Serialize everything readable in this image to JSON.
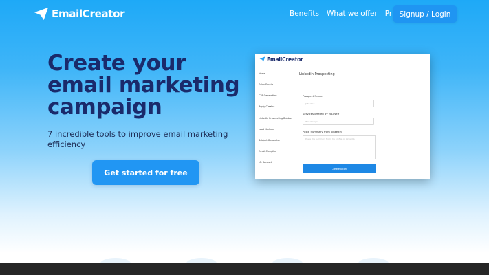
{
  "brand": {
    "name": "EmailCreator",
    "logo_icon": "paper-plane-icon",
    "color": "#ffffff"
  },
  "nav": {
    "links": [
      "Benefits",
      "What we offer",
      "Pricing"
    ],
    "signup_label": "Signup / Login"
  },
  "hero": {
    "title": "Create your email marketing campaign",
    "subtitle": "7 incredible tools to improve email marketing efficiency",
    "cta_label": "Get started for free"
  },
  "preview": {
    "brand_name": "EmailCreator",
    "sidebar_items": [
      "Home",
      "Sales Emails",
      "CTA Generation",
      "Reply Creator",
      "LinkedIn Prospecting Bubble",
      "Lead Nurture",
      "Subject Generator",
      "Email Compiler",
      "My Account"
    ],
    "page_title": "Linkedin Prospecting",
    "fields": [
      {
        "label": "Prospect Name",
        "placeholder": "John Doe"
      },
      {
        "label": "Services offered by yourself",
        "placeholder": "Web Design"
      }
    ],
    "textarea_label": "Paste Summary from LinkedIn",
    "textarea_placeholder": "Paste the summary from the profile on LinkedIn",
    "button_label": "Create pitch"
  },
  "colors": {
    "accent": "#2196f3",
    "title": "#1a2a6b",
    "background_top": "#1ea9f7"
  }
}
